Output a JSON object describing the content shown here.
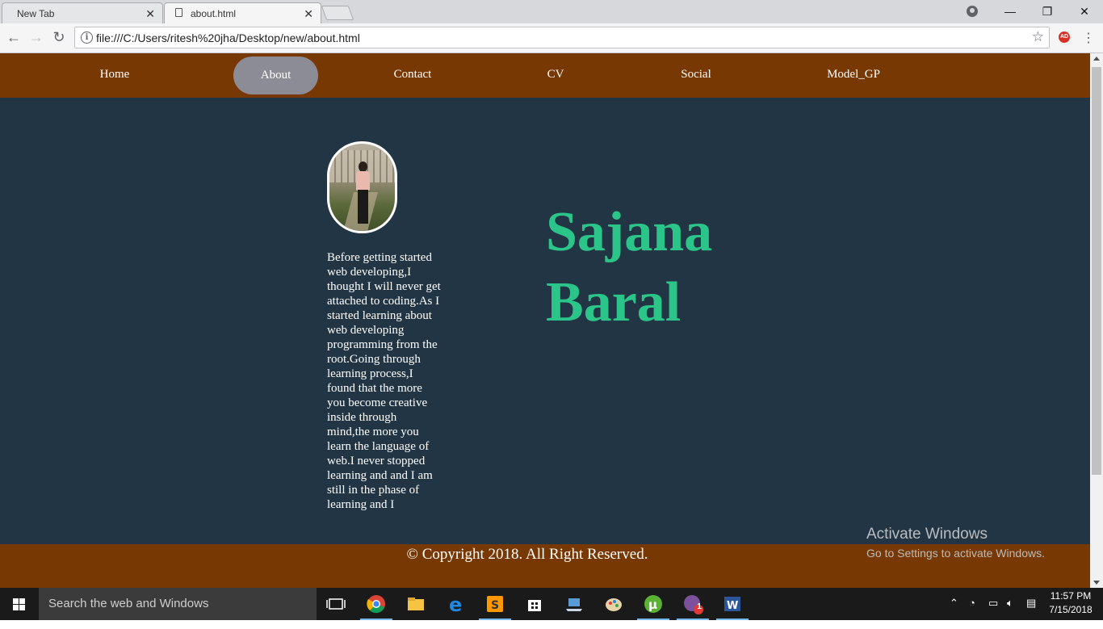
{
  "browser": {
    "tabs": [
      {
        "title": "New Tab",
        "active": false
      },
      {
        "title": "about.html",
        "active": true
      }
    ],
    "url": "file:///C:/Users/ritesh%20jha/Desktop/new/about.html",
    "extension_badge": "AD"
  },
  "site": {
    "nav": [
      "Home",
      "About",
      "Contact",
      "CV",
      "Social",
      "Model_GP"
    ],
    "active_nav": "About",
    "name_line1": "Sajana",
    "name_line2": "Baral",
    "about_text": "Before getting started web developing,I thought I will never get attached to coding.As I started learning about web developing programming from the root.Going through learning process,I found that the more you become creative inside through mind,the more you learn the language of web.I never stopped learning and and I am still in the phase of learning and I",
    "footer": "© Copyright 2018. All Right Reserved.",
    "colors": {
      "nav_bg": "#773804",
      "page_bg": "#223544",
      "accent_green": "#2bc589",
      "active_pill": "#8c8c96"
    }
  },
  "watermark": {
    "title": "Activate Windows",
    "subtitle": "Go to Settings to activate Windows."
  },
  "taskbar": {
    "search_placeholder": "Search the web and Windows",
    "time": "11:57 PM",
    "date": "7/15/2018",
    "viber_badge": "1",
    "apps": [
      "task-view-icon",
      "chrome-icon",
      "file-explorer-icon",
      "edge-icon",
      "sublime-text-icon",
      "store-icon",
      "laptop-icon",
      "paint-icon",
      "utorrent-icon",
      "viber-icon",
      "word-icon"
    ]
  }
}
